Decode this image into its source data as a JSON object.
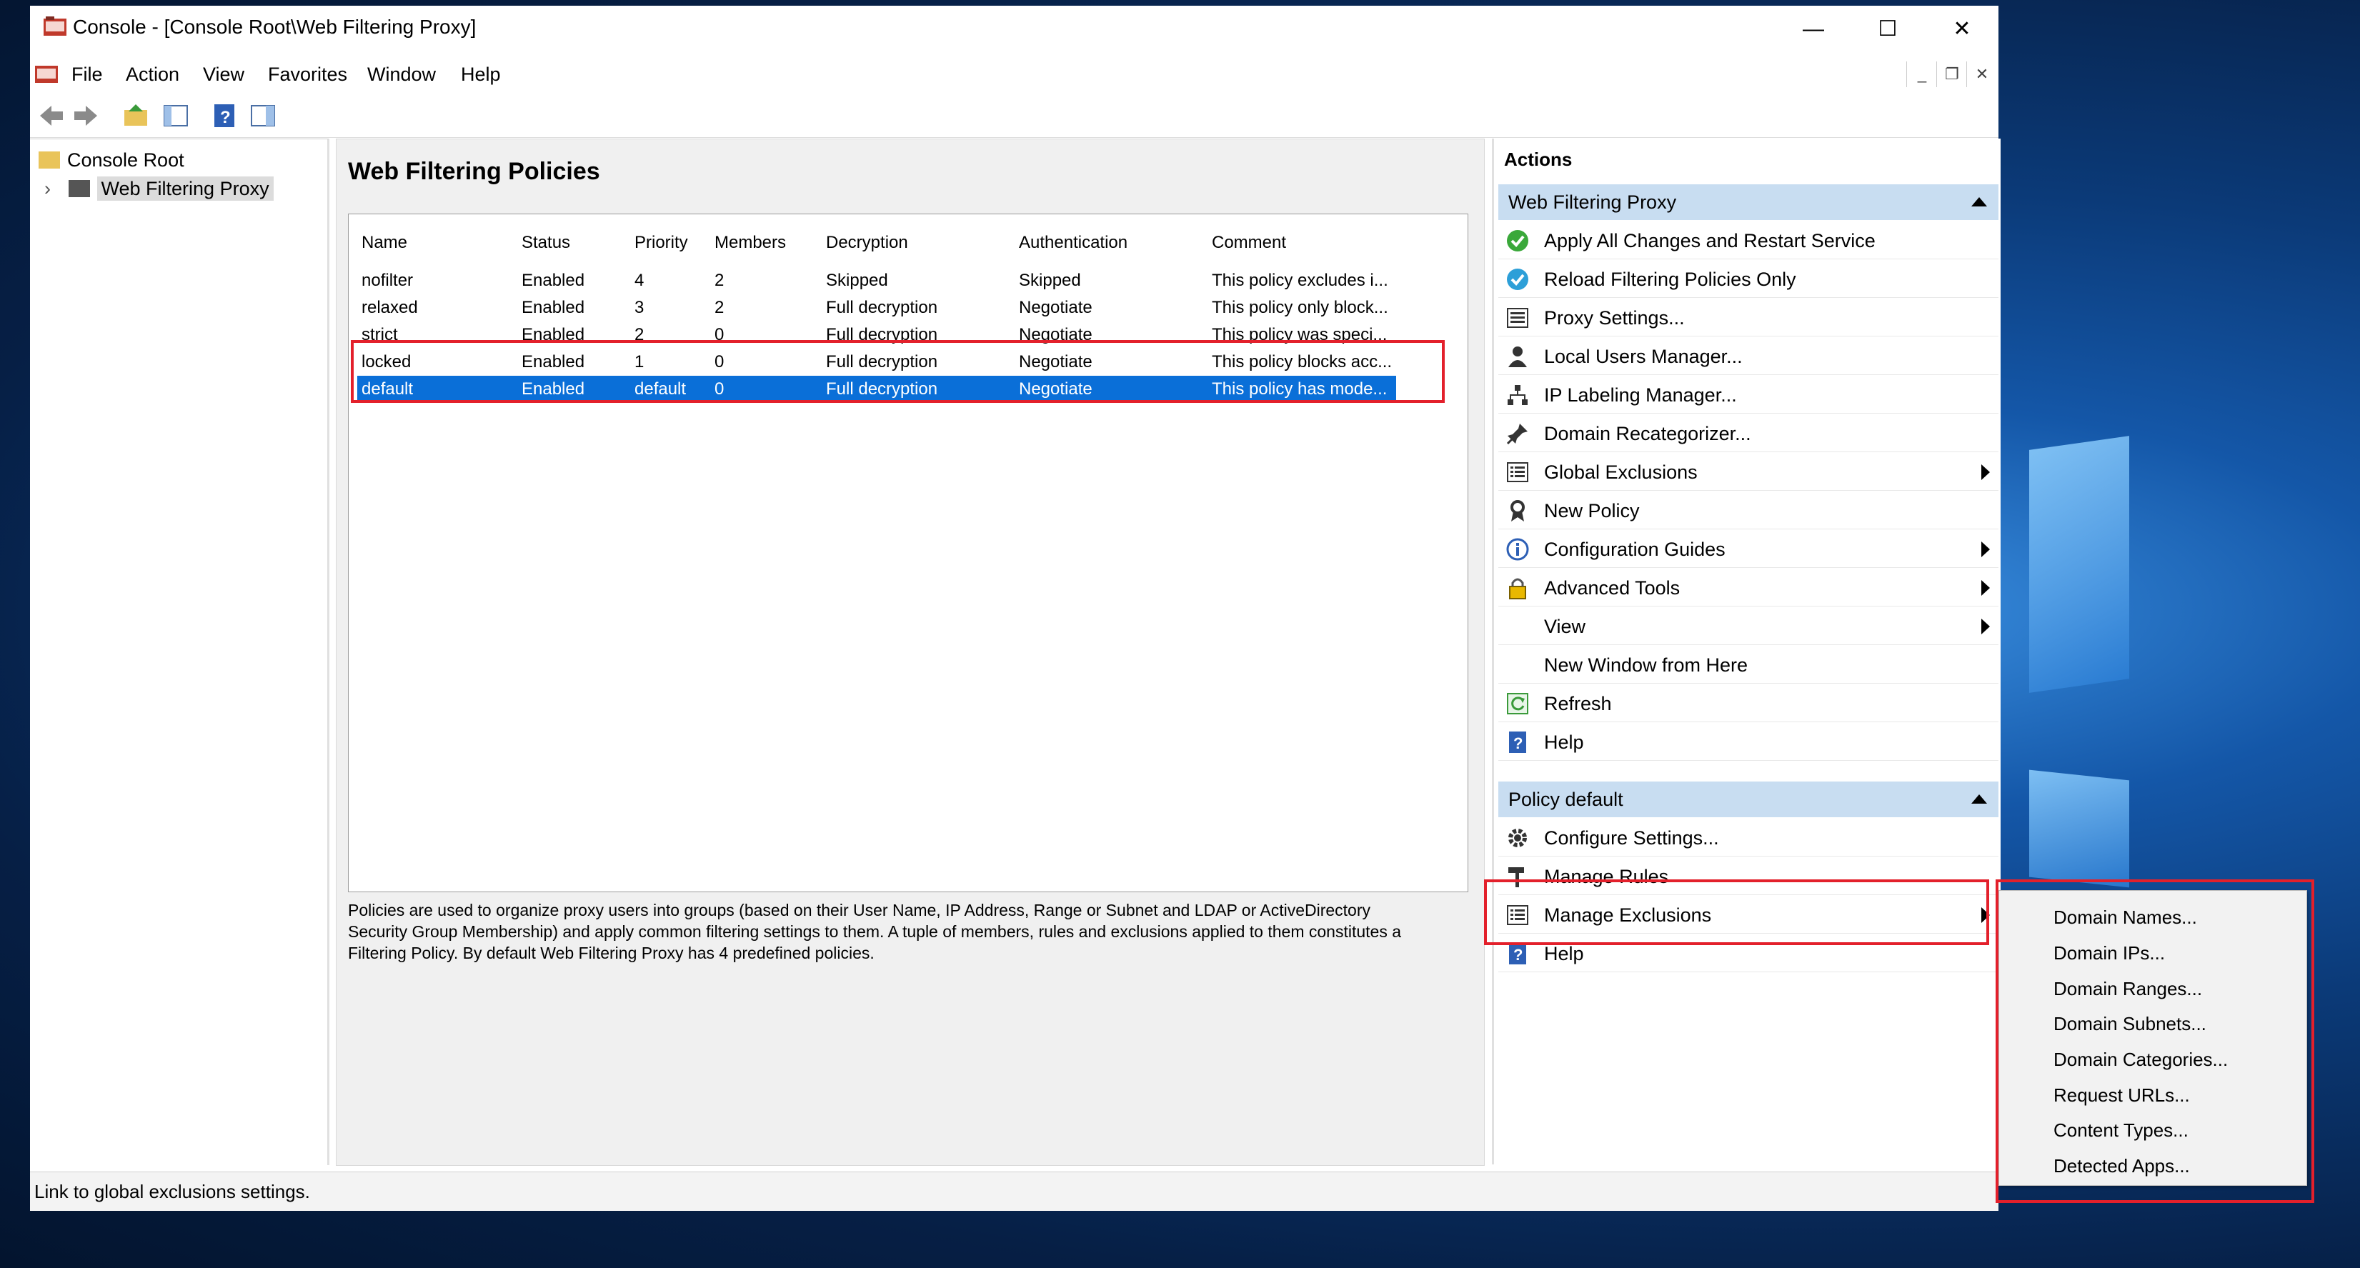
{
  "window": {
    "title": "Console - [Console Root\\Web Filtering Proxy]",
    "caption_buttons": {
      "minimize": "—",
      "maximize": "☐",
      "close": "✕"
    }
  },
  "menu": [
    "File",
    "Action",
    "View",
    "Favorites",
    "Window",
    "Help"
  ],
  "mdi_buttons": {
    "minimize": "_",
    "restore": "❐",
    "close": "✕"
  },
  "tree": {
    "root": "Console Root",
    "child": "Web Filtering Proxy"
  },
  "center": {
    "heading": "Web Filtering Policies",
    "columns": [
      "Name",
      "Status",
      "Priority",
      "Members",
      "Decryption",
      "Authentication",
      "Comment"
    ],
    "rows": [
      [
        "nofilter",
        "Enabled",
        "4",
        "2",
        "Skipped",
        "Skipped",
        "This policy excludes i..."
      ],
      [
        "relaxed",
        "Enabled",
        "3",
        "2",
        "Full decryption",
        "Negotiate",
        "This policy only block..."
      ],
      [
        "strict",
        "Enabled",
        "2",
        "0",
        "Full decryption",
        "Negotiate",
        "This policy was speci..."
      ],
      [
        "locked",
        "Enabled",
        "1",
        "0",
        "Full decryption",
        "Negotiate",
        "This policy blocks acc..."
      ],
      [
        "default",
        "Enabled",
        "default",
        "0",
        "Full decryption",
        "Negotiate",
        "This policy has mode..."
      ]
    ],
    "selected_row": 4,
    "description": [
      "Policies are used to organize proxy users into groups (based on their User Name, IP Address, Range or Subnet and LDAP or ActiveDirectory",
      "Security Group Membership) and apply common filtering settings to them. A tuple of members, rules and exclusions applied to them constitutes a",
      "Filtering Policy. By default Web Filtering Proxy has 4 predefined policies."
    ]
  },
  "actions": {
    "title": "Actions",
    "section1": {
      "title": "Web Filtering Proxy",
      "items": [
        {
          "label": "Apply All Changes and Restart Service",
          "icon": "check-circle-icon",
          "submenu": false
        },
        {
          "label": "Reload Filtering Policies Only",
          "icon": "check-circle-icon",
          "submenu": false
        },
        {
          "label": "Proxy Settings...",
          "icon": "settings-list-icon",
          "submenu": false
        },
        {
          "label": "Local Users Manager...",
          "icon": "user-icon",
          "submenu": false
        },
        {
          "label": "IP Labeling Manager...",
          "icon": "network-icon",
          "submenu": false
        },
        {
          "label": "Domain Recategorizer...",
          "icon": "pin-icon",
          "submenu": false
        },
        {
          "label": "Global Exclusions",
          "icon": "list-icon",
          "submenu": true
        },
        {
          "label": "New Policy",
          "icon": "ribbon-icon",
          "submenu": false
        },
        {
          "label": "Configuration Guides",
          "icon": "info-icon",
          "submenu": true
        },
        {
          "label": "Advanced Tools",
          "icon": "lock-icon",
          "submenu": true
        },
        {
          "label": "View",
          "icon": "",
          "submenu": true
        },
        {
          "label": "New Window from Here",
          "icon": "",
          "submenu": false
        },
        {
          "label": "Refresh",
          "icon": "refresh-icon",
          "submenu": false
        },
        {
          "label": "Help",
          "icon": "help-icon",
          "submenu": false
        }
      ]
    },
    "section2": {
      "title": "Policy default",
      "items": [
        {
          "label": "Configure Settings...",
          "icon": "gear-icon",
          "submenu": false
        },
        {
          "label": "Manage Rules",
          "icon": "hammer-icon",
          "submenu": false
        },
        {
          "label": "Manage Exclusions",
          "icon": "list-icon",
          "submenu": true
        },
        {
          "label": "Help",
          "icon": "help-icon",
          "submenu": false
        }
      ]
    }
  },
  "flyout": [
    "Domain Names...",
    "Domain IPs...",
    "Domain Ranges...",
    "Domain Subnets...",
    "Domain Categories...",
    "Request URLs...",
    "Content Types...",
    "Detected Apps..."
  ],
  "status": "Link to global exclusions settings.",
  "colors": {
    "selection": "#0a6fd8",
    "section_header": "#c8ddf1",
    "highlight_box": "#e3202b"
  }
}
